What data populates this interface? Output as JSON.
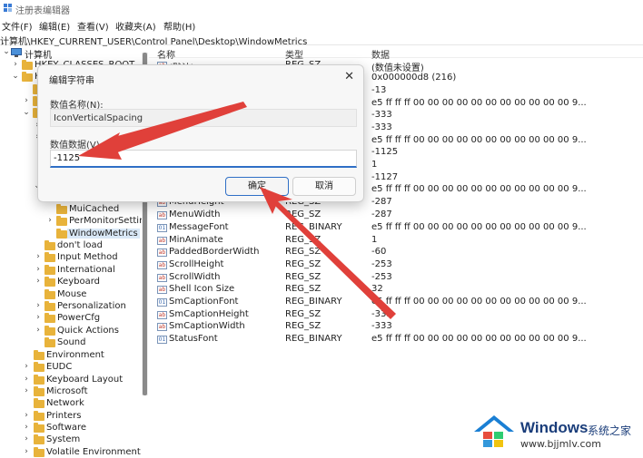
{
  "window": {
    "title": "注册表编辑器"
  },
  "menu": [
    "文件(F)",
    "编辑(E)",
    "查看(V)",
    "收藏夹(A)",
    "帮助(H)"
  ],
  "address": "计算机\\HKEY_CURRENT_USER\\Control Panel\\Desktop\\WindowMetrics",
  "tree": {
    "computer": "计算机",
    "hkcr": "HKEY_CLASSES_ROOT",
    "hkcu_partial": "H",
    "items": [
      "MuiCached",
      "PerMonitorSettin",
      "WindowMetrics",
      "don't load",
      "Input Method",
      "International",
      "Keyboard",
      "Mouse",
      "Personalization",
      "PowerCfg",
      "Quick Actions",
      "Sound",
      "Environment",
      "EUDC",
      "Keyboard Layout",
      "Microsoft",
      "Network",
      "Printers",
      "Software",
      "System",
      "Volatile Environment"
    ]
  },
  "columns": {
    "name": "名称",
    "type": "类型",
    "data": "数据"
  },
  "rows_top": [
    {
      "name": "(默认)",
      "type": "REG_SZ",
      "data": "(数值未设置)"
    },
    {
      "name": "",
      "type": "",
      "data": "0x000000d8 (216)"
    },
    {
      "name": "",
      "type": "",
      "data": "-13"
    },
    {
      "name": "",
      "type": "",
      "data": "e5 ff ff ff 00 00 00 00 00 00 00 00 00 00 00 9..."
    },
    {
      "name": "",
      "type": "",
      "data": "-333"
    },
    {
      "name": "",
      "type": "",
      "data": "-333"
    },
    {
      "name": "",
      "type": "",
      "data": "e5 ff ff ff 00 00 00 00 00 00 00 00 00 00 00 9..."
    },
    {
      "name": "",
      "type": "",
      "data": "-1125"
    },
    {
      "name": "",
      "type": "",
      "data": "1"
    },
    {
      "name": "",
      "type": "",
      "data": "-1127"
    },
    {
      "name": "",
      "type": "",
      "data": "e5 ff ff ff 00 00 00 00 00 00 00 00 00 00 00 9..."
    },
    {
      "name": "MenuHeight",
      "type": "REG_SZ",
      "data": "-287"
    }
  ],
  "rows": [
    {
      "name": "MenuWidth",
      "type": "REG_SZ",
      "data": "-287",
      "bin": false
    },
    {
      "name": "MessageFont",
      "type": "REG_BINARY",
      "data": "e5 ff ff ff 00 00 00 00 00 00 00 00 00 00 00 9...",
      "bin": true
    },
    {
      "name": "MinAnimate",
      "type": "REG_SZ",
      "data": "1",
      "bin": false
    },
    {
      "name": "PaddedBorderWidth",
      "type": "REG_SZ",
      "data": "-60",
      "bin": false
    },
    {
      "name": "ScrollHeight",
      "type": "REG_SZ",
      "data": "-253",
      "bin": false
    },
    {
      "name": "ScrollWidth",
      "type": "REG_SZ",
      "data": "-253",
      "bin": false
    },
    {
      "name": "Shell Icon Size",
      "type": "REG_SZ",
      "data": "32",
      "bin": false
    },
    {
      "name": "SmCaptionFont",
      "type": "REG_BINARY",
      "data": "e5 ff ff ff 00 00 00 00 00 00 00 00 00 00 00 9...",
      "bin": true
    },
    {
      "name": "SmCaptionHeight",
      "type": "REG_SZ",
      "data": "-333",
      "bin": false
    },
    {
      "name": "SmCaptionWidth",
      "type": "REG_SZ",
      "data": "-333",
      "bin": false
    },
    {
      "name": "StatusFont",
      "type": "REG_BINARY",
      "data": "e5 ff ff ff 00 00 00 00 00 00 00 00 00 00 00 9...",
      "bin": true
    }
  ],
  "dialog": {
    "title": "编辑字符串",
    "name_label": "数值名称(N):",
    "name_value": "IconVerticalSpacing",
    "data_label": "数值数据(V):",
    "data_value": "-1125",
    "ok": "确定",
    "cancel": "取消"
  },
  "watermark": {
    "brand": "Windows",
    "suffix": "系统之家",
    "url": "www.bjjmlv.com"
  },
  "colors": {
    "accent": "#2f6fc6",
    "arrow": "#e0403a",
    "folder": "#e8b33b"
  }
}
